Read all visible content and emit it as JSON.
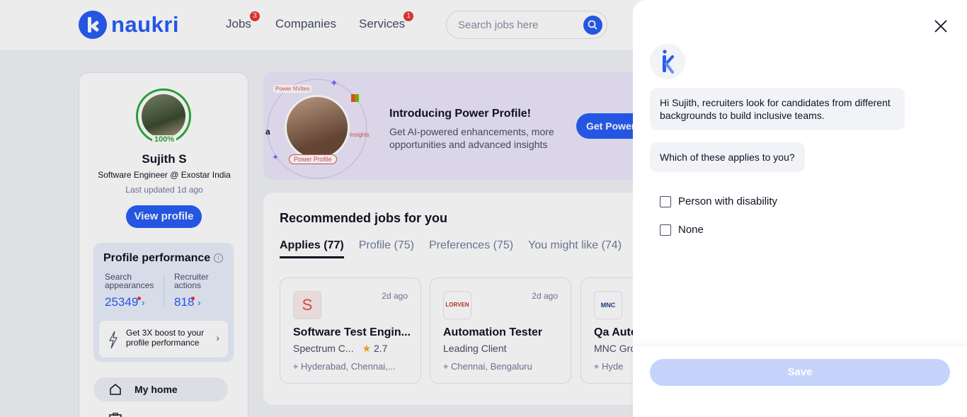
{
  "header": {
    "logo_text": "naukri",
    "nav": [
      {
        "label": "Jobs",
        "badge": "3"
      },
      {
        "label": "Companies"
      },
      {
        "label": "Services",
        "badge": "1"
      }
    ],
    "search_placeholder": "Search jobs here"
  },
  "profile": {
    "completion": "100%",
    "name": "Sujith S",
    "headline": "Software Engineer @ Exostar India",
    "updated": "Last updated 1d ago",
    "view_profile_label": "View profile",
    "performance": {
      "title": "Profile performance",
      "search_label": "Search appearances",
      "search_value": "25349",
      "recruiter_label": "Recruiter actions",
      "recruiter_value": "818",
      "boost_text": "Get 3X boost to your profile performance"
    },
    "nav_home": "My home"
  },
  "banner": {
    "tag_nvites": "Power NVites",
    "tag_insights": "Insights",
    "tag_profile": "Power Profile",
    "title": "Introducing Power Profile!",
    "description": "Get AI-powered enhancements, more opportunities and advanced insights",
    "button": "Get Power"
  },
  "recommended": {
    "title": "Recommended jobs for you",
    "tabs": [
      "Applies (77)",
      "Profile (75)",
      "Preferences (75)",
      "You might like (74)"
    ],
    "jobs": [
      {
        "logo": "S",
        "posted": "2d ago",
        "title": "Software Test Engin...",
        "company": "Spectrum C...",
        "rating": "2.7",
        "location": "Hyderabad, Chennai,..."
      },
      {
        "logo": "LORVEN",
        "posted": "2d ago",
        "title": "Automation Tester",
        "company": "Leading Client",
        "location": "Chennai, Bengaluru"
      },
      {
        "logo": "MNC",
        "posted": "",
        "title": "Qa Auto",
        "company": "MNC Gro",
        "location": "Hyde"
      }
    ]
  },
  "drawer": {
    "message_1": "Hi Sujith, recruiters look for candidates from different backgrounds to build inclusive teams.",
    "message_2": "Which of these applies to you?",
    "options": [
      "Person with disability",
      "None"
    ],
    "save_label": "Save"
  },
  "colors": {
    "brand": "#275df5",
    "save_disabled": "#c5d3fb",
    "success": "#2daa3a"
  }
}
